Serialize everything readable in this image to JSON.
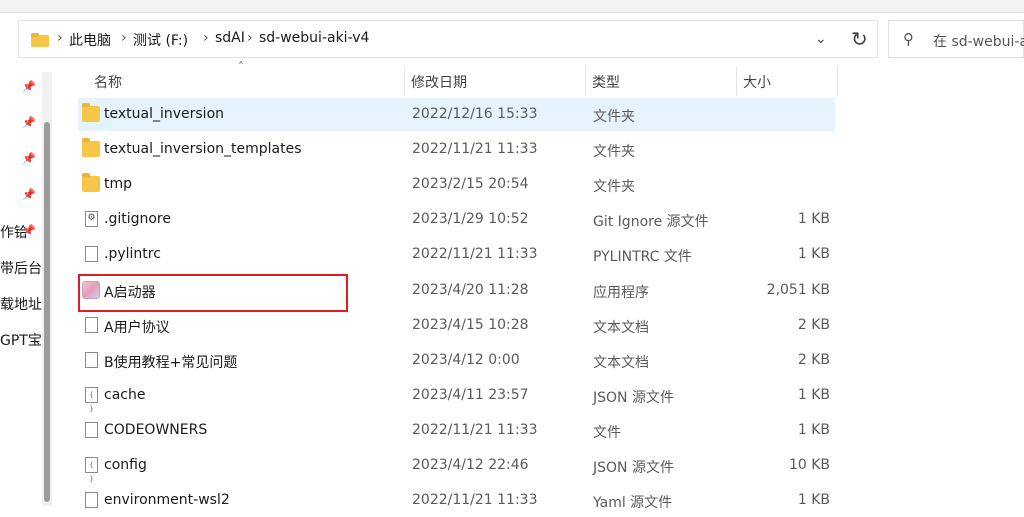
{
  "address": {
    "crumbs": [
      "此电脑",
      "测试 (F:)",
      "sdAI",
      "sd-webui-aki-v4"
    ],
    "separator": "›"
  },
  "search": {
    "placeholder": "在 sd-webui-a"
  },
  "nav": {
    "items": [
      "作铪",
      "带后台",
      "载地址",
      "GPT宝"
    ]
  },
  "columns": {
    "name": "名称",
    "date": "修改日期",
    "type": "类型",
    "size": "大小"
  },
  "files": [
    {
      "name": "textual_inversion",
      "date": "2022/12/16 15:33",
      "type": "文件夹",
      "size": "",
      "icon": "folder-icon"
    },
    {
      "name": "textual_inversion_templates",
      "date": "2022/11/21 11:33",
      "type": "文件夹",
      "size": "",
      "icon": "folder-icon"
    },
    {
      "name": "tmp",
      "date": "2023/2/15 20:54",
      "type": "文件夹",
      "size": "",
      "icon": "folder-icon"
    },
    {
      "name": ".gitignore",
      "date": "2023/1/29 10:52",
      "type": "Git Ignore 源文件",
      "size": "1 KB",
      "icon": "gear-file-icon"
    },
    {
      "name": ".pylintrc",
      "date": "2022/11/21 11:33",
      "type": "PYLINTRC 文件",
      "size": "1 KB",
      "icon": "file-icon"
    },
    {
      "name": "A启动器",
      "date": "2023/4/20 11:28",
      "type": "应用程序",
      "size": "2,051 KB",
      "icon": "app-icon"
    },
    {
      "name": "A用户协议",
      "date": "2023/4/15 10:28",
      "type": "文本文档",
      "size": "2 KB",
      "icon": "file-icon"
    },
    {
      "name": "B使用教程+常见问题",
      "date": "2023/4/12 0:00",
      "type": "文本文档",
      "size": "2 KB",
      "icon": "file-icon"
    },
    {
      "name": "cache",
      "date": "2023/4/11 23:57",
      "type": "JSON 源文件",
      "size": "1 KB",
      "icon": "json-file-icon"
    },
    {
      "name": "CODEOWNERS",
      "date": "2022/11/21 11:33",
      "type": "文件",
      "size": "1 KB",
      "icon": "file-icon"
    },
    {
      "name": "config",
      "date": "2023/4/12 22:46",
      "type": "JSON 源文件",
      "size": "10 KB",
      "icon": "json-file-icon"
    },
    {
      "name": "environment-wsl2",
      "date": "2022/11/21 11:33",
      "type": "Yaml 源文件",
      "size": "1 KB",
      "icon": "file-icon"
    }
  ],
  "colors": {
    "selected_row": "#e5f3ff",
    "highlight_box": "#e01b24",
    "folder": "#f7c648"
  }
}
